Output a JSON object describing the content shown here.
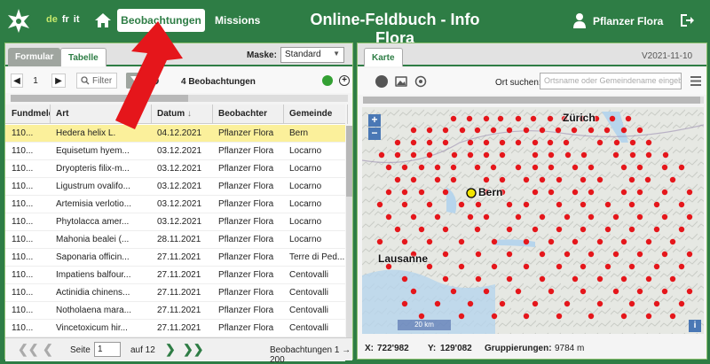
{
  "header": {
    "languages": [
      "de",
      "fr",
      "it"
    ],
    "active_language": "de",
    "nav_observations": "Beobachtungen",
    "nav_missions": "Missions",
    "title": "Online-Feldbuch  -  Info Flora",
    "user": "Pflanzer Flora",
    "brand_color": "#2e7d45"
  },
  "left_panel": {
    "tabs": [
      "Formular",
      "Tabelle"
    ],
    "active_tab": "Tabelle",
    "mask_label": "Maske:",
    "mask_value": "Standard",
    "toolbar": {
      "page_value": "1",
      "filter_label": "Filter",
      "observation_count": "4 Beobachtungen"
    },
    "columns": [
      "Fundmeld",
      "Art",
      "Datum",
      "Beobachter",
      "Gemeinde"
    ],
    "rows": [
      {
        "id": "110...",
        "art": "Hedera helix L.",
        "datum": "04.12.2021",
        "beobachter": "Pflanzer Flora",
        "gemeinde": "Bern",
        "selected": true
      },
      {
        "id": "110...",
        "art": "Equisetum hyem...",
        "datum": "03.12.2021",
        "beobachter": "Pflanzer Flora",
        "gemeinde": "Locarno"
      },
      {
        "id": "110...",
        "art": "Dryopteris filix-m...",
        "datum": "03.12.2021",
        "beobachter": "Pflanzer Flora",
        "gemeinde": "Locarno"
      },
      {
        "id": "110...",
        "art": "Ligustrum ovalifo...",
        "datum": "03.12.2021",
        "beobachter": "Pflanzer Flora",
        "gemeinde": "Locarno"
      },
      {
        "id": "110...",
        "art": "Artemisia verlotio...",
        "datum": "03.12.2021",
        "beobachter": "Pflanzer Flora",
        "gemeinde": "Locarno"
      },
      {
        "id": "110...",
        "art": "Phytolacca amer...",
        "datum": "03.12.2021",
        "beobachter": "Pflanzer Flora",
        "gemeinde": "Locarno"
      },
      {
        "id": "110...",
        "art": "Mahonia bealei (...",
        "datum": "28.11.2021",
        "beobachter": "Pflanzer Flora",
        "gemeinde": "Locarno"
      },
      {
        "id": "110...",
        "art": "Saponaria officin...",
        "datum": "27.11.2021",
        "beobachter": "Pflanzer Flora",
        "gemeinde": "Terre di Ped..."
      },
      {
        "id": "110...",
        "art": "Impatiens balfour...",
        "datum": "27.11.2021",
        "beobachter": "Pflanzer Flora",
        "gemeinde": "Centovalli"
      },
      {
        "id": "110...",
        "art": "Actinidia chinens...",
        "datum": "27.11.2021",
        "beobachter": "Pflanzer Flora",
        "gemeinde": "Centovalli"
      },
      {
        "id": "110...",
        "art": "Notholaena mara...",
        "datum": "27.11.2021",
        "beobachter": "Pflanzer Flora",
        "gemeinde": "Centovalli"
      },
      {
        "id": "110...",
        "art": "Vincetoxicum hir...",
        "datum": "27.11.2021",
        "beobachter": "Pflanzer Flora",
        "gemeinde": "Centovalli"
      }
    ],
    "pager": {
      "page_label": "Seite",
      "page_value": "1",
      "of_label": "auf 12",
      "range_label": "Beobachtungen 1 → 200"
    }
  },
  "right_panel": {
    "tab": "Karte",
    "version": "V2021-11-10",
    "search_label": "Ort suchen:",
    "search_placeholder": "Ortsname oder Gemeindename eingeben",
    "cities": [
      "Zürich",
      "Bern",
      "Lausanne"
    ],
    "scale_label": "20 km",
    "status": {
      "x_label": "X:",
      "x_value": "722'982",
      "y_label": "Y:",
      "y_value": "129'082",
      "grouping_label": "Gruppierungen:",
      "grouping_value": "9784 m"
    },
    "marker_color": "#e5161b"
  }
}
